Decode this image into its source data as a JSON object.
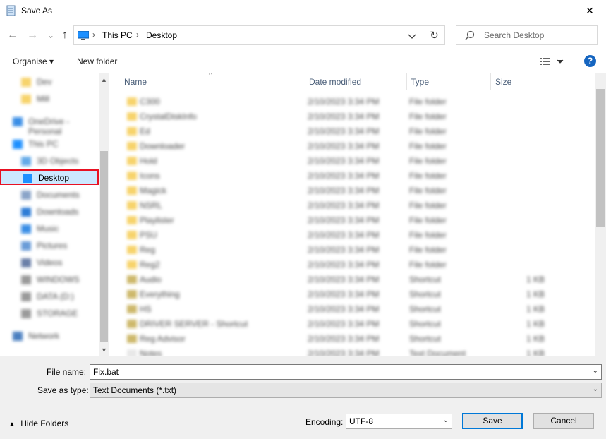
{
  "window": {
    "title": "Save As",
    "close_glyph": "✕"
  },
  "nav": {
    "back_glyph": "←",
    "forward_glyph": "→",
    "recent_glyph": "⌄",
    "up_glyph": "↑",
    "breadcrumbs": [
      "This PC",
      "Desktop"
    ],
    "refresh_glyph": "↻",
    "search_placeholder": "Search Desktop"
  },
  "toolbar": {
    "organise_label": "Organise ▾",
    "new_folder_label": "New folder",
    "help_label": "?"
  },
  "sidebar": {
    "items": [
      {
        "label": "Dev",
        "blurred": true,
        "icon": "folder-icon"
      },
      {
        "label": "Mill",
        "blurred": true,
        "icon": "folder-icon"
      },
      {
        "label": "OneDrive - Personal",
        "blurred": true,
        "icon": "onedrive-icon"
      },
      {
        "label": "This PC",
        "blurred": true,
        "icon": "pc-icon"
      },
      {
        "label": "3D Objects",
        "blurred": true,
        "icon": "cube-icon"
      },
      {
        "label": "Desktop",
        "blurred": false,
        "selected": true,
        "icon": "desktop-icon"
      },
      {
        "label": "Documents",
        "blurred": true,
        "icon": "documents-icon"
      },
      {
        "label": "Downloads",
        "blurred": true,
        "icon": "downloads-icon"
      },
      {
        "label": "Music",
        "blurred": true,
        "icon": "music-icon"
      },
      {
        "label": "Pictures",
        "blurred": true,
        "icon": "pictures-icon"
      },
      {
        "label": "Videos",
        "blurred": true,
        "icon": "videos-icon"
      },
      {
        "label": "WINDOWS",
        "blurred": true,
        "icon": "drive-icon"
      },
      {
        "label": "DATA (D:)",
        "blurred": true,
        "icon": "drive-icon"
      },
      {
        "label": "STORAGE",
        "blurred": true,
        "icon": "drive-icon"
      },
      {
        "label": "Network",
        "blurred": true,
        "icon": "network-icon"
      }
    ]
  },
  "files": {
    "columns": [
      "Name",
      "Date modified",
      "Type",
      "Size"
    ],
    "rows": [
      {
        "name": "C300",
        "date": "2/10/2023 3:34 PM",
        "type": "File folder",
        "size": ""
      },
      {
        "name": "CrystalDiskInfo",
        "date": "2/10/2023 3:34 PM",
        "type": "File folder",
        "size": ""
      },
      {
        "name": "Ed",
        "date": "2/10/2023 3:34 PM",
        "type": "File folder",
        "size": ""
      },
      {
        "name": "Downloader",
        "date": "2/10/2023 3:34 PM",
        "type": "File folder",
        "size": ""
      },
      {
        "name": "Hold",
        "date": "2/10/2023 3:34 PM",
        "type": "File folder",
        "size": ""
      },
      {
        "name": "Icons",
        "date": "2/10/2023 3:34 PM",
        "type": "File folder",
        "size": ""
      },
      {
        "name": "Magick",
        "date": "2/10/2023 3:34 PM",
        "type": "File folder",
        "size": ""
      },
      {
        "name": "NSRL",
        "date": "2/10/2023 3:34 PM",
        "type": "File folder",
        "size": ""
      },
      {
        "name": "Playlister",
        "date": "2/10/2023 3:34 PM",
        "type": "File folder",
        "size": ""
      },
      {
        "name": "PSU",
        "date": "2/10/2023 3:34 PM",
        "type": "File folder",
        "size": ""
      },
      {
        "name": "Reg",
        "date": "2/10/2023 3:34 PM",
        "type": "File folder",
        "size": ""
      },
      {
        "name": "Reg2",
        "date": "2/10/2023 3:34 PM",
        "type": "File folder",
        "size": ""
      },
      {
        "name": "Audio",
        "date": "2/10/2023 3:34 PM",
        "type": "Shortcut",
        "size": "1 KB"
      },
      {
        "name": "Everything",
        "date": "2/10/2023 3:34 PM",
        "type": "Shortcut",
        "size": "1 KB"
      },
      {
        "name": "HS",
        "date": "2/10/2023 3:34 PM",
        "type": "Shortcut",
        "size": "1 KB"
      },
      {
        "name": "DRIVER SERVER - Shortcut",
        "date": "2/10/2023 3:34 PM",
        "type": "Shortcut",
        "size": "1 KB"
      },
      {
        "name": "Reg Advisor",
        "date": "2/10/2023 3:34 PM",
        "type": "Shortcut",
        "size": "1 KB"
      },
      {
        "name": "Notes",
        "date": "2/10/2023 3:34 PM",
        "type": "Text Document",
        "size": "1 KB"
      }
    ]
  },
  "form": {
    "filename_label": "File name:",
    "filename_value": "Fix.bat",
    "type_label": "Save as type:",
    "type_value": "Text Documents (*.txt)",
    "encoding_label": "Encoding:",
    "encoding_value": "UTF-8",
    "hide_folders_label": "Hide Folders",
    "save_label": "Save",
    "cancel_label": "Cancel"
  },
  "colors": {
    "accent": "#0078d7",
    "highlight_box": "#e81123",
    "folder": "#f7d36b"
  }
}
